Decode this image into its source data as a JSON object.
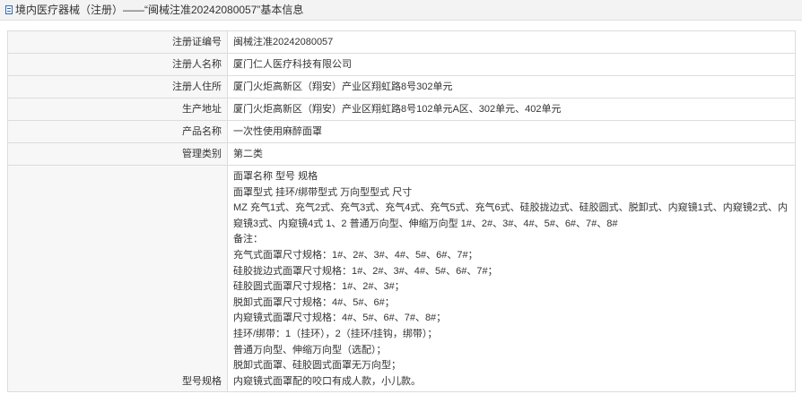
{
  "header": {
    "title": "境内医疗器械（注册）——“闽械注准20242080057”基本信息"
  },
  "rows": [
    {
      "label": "注册证编号",
      "value": "闽械注准20242080057"
    },
    {
      "label": "注册人名称",
      "value": "厦门仁人医疗科技有限公司"
    },
    {
      "label": "注册人住所",
      "value": "厦门火炬高新区（翔安）产业区翔虹路8号302单元"
    },
    {
      "label": "生产地址",
      "value": "厦门火炬高新区（翔安）产业区翔虹路8号102单元A区、302单元、402单元"
    },
    {
      "label": "产品名称",
      "value": "一次性使用麻醉面罩"
    },
    {
      "label": "管理类别",
      "value": "第二类"
    }
  ],
  "spec": {
    "label": "型号规格",
    "lines": [
      "面罩名称 型号 规格",
      "面罩型式 挂环/绑带型式 万向型型式 尺寸",
      "MZ 充气1式、充气2式、充气3式、充气4式、充气5式、充气6式、硅胶拢边式、硅胶圆式、脱卸式、内窥镜1式、内窥镜2式、内窥镜3式、内窥镜4式 1、2 普通万向型、伸缩万向型 1#、2#、3#、4#、5#、6#、7#、8#",
      "备注：",
      "充气式面罩尺寸规格：1#、2#、3#、4#、5#、6#、7#；",
      "硅胶拢边式面罩尺寸规格：1#、2#、3#、4#、5#、6#、7#；",
      "硅胶圆式面罩尺寸规格：1#、2#、3#；",
      "脱卸式面罩尺寸规格：4#、5#、6#；",
      "内窥镜式面罩尺寸规格：4#、5#、6#、7#、8#；",
      "挂环/绑带：1（挂环），2（挂环/挂钩，绑带）；",
      "普通万向型、伸缩万向型（选配）；",
      "脱卸式面罩、硅胶圆式面罩无万向型；",
      "内窥镜式面罩配的咬口有成人款，小儿款。"
    ]
  }
}
